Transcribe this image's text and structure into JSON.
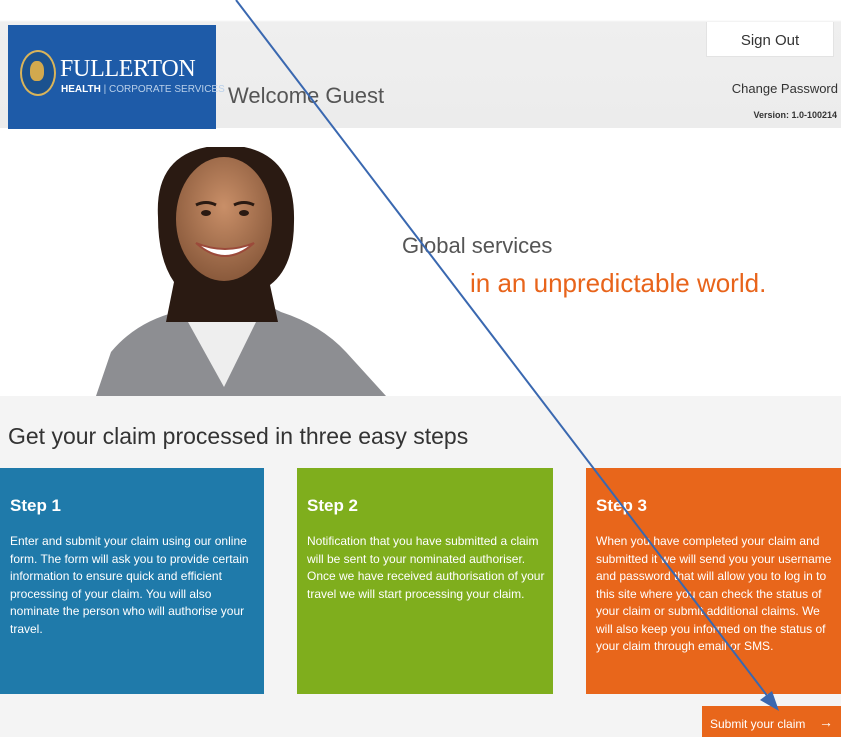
{
  "header": {
    "logo_name": "FULLERTON",
    "logo_sub_bold": "HEALTH",
    "logo_sub_sep": "|",
    "logo_sub_rest": "CORPORATE SERVICES",
    "welcome": "Welcome Guest",
    "sign_out": "Sign Out",
    "change_password": "Change Password",
    "version": "Version: 1.0-100214"
  },
  "banner": {
    "line1": "Global services",
    "line2": "in an unpredictable world."
  },
  "steps_section": {
    "heading": "Get your claim processed in three easy steps",
    "steps": [
      {
        "title": "Step 1",
        "text": "Enter and submit your claim using our online form. The form will ask you to provide certain information to ensure quick and efficient processing of your claim. You will also nominate the person who will authorise your travel."
      },
      {
        "title": "Step 2",
        "text": "Notification that you have submitted a claim will be sent to your nominated authoriser. Once we have received authorisation of your travel we will start processing your claim."
      },
      {
        "title": "Step 3",
        "text": "When you have completed your claim and submitted it we will send you your username and password that will allow you to log in to this site where you can check the status of your claim or submit additional claims. We will also keep you informed on the status of your claim through email or SMS."
      }
    ]
  },
  "submit": {
    "label": "Submit your claim",
    "arrow": "→"
  },
  "colors": {
    "brand_blue": "#1e5ba8",
    "step1": "#1f7aaa",
    "step2": "#7fae1d",
    "step3": "#e8661b",
    "accent_orange": "#e8641b",
    "annotation_arrow": "#3a68b0"
  }
}
